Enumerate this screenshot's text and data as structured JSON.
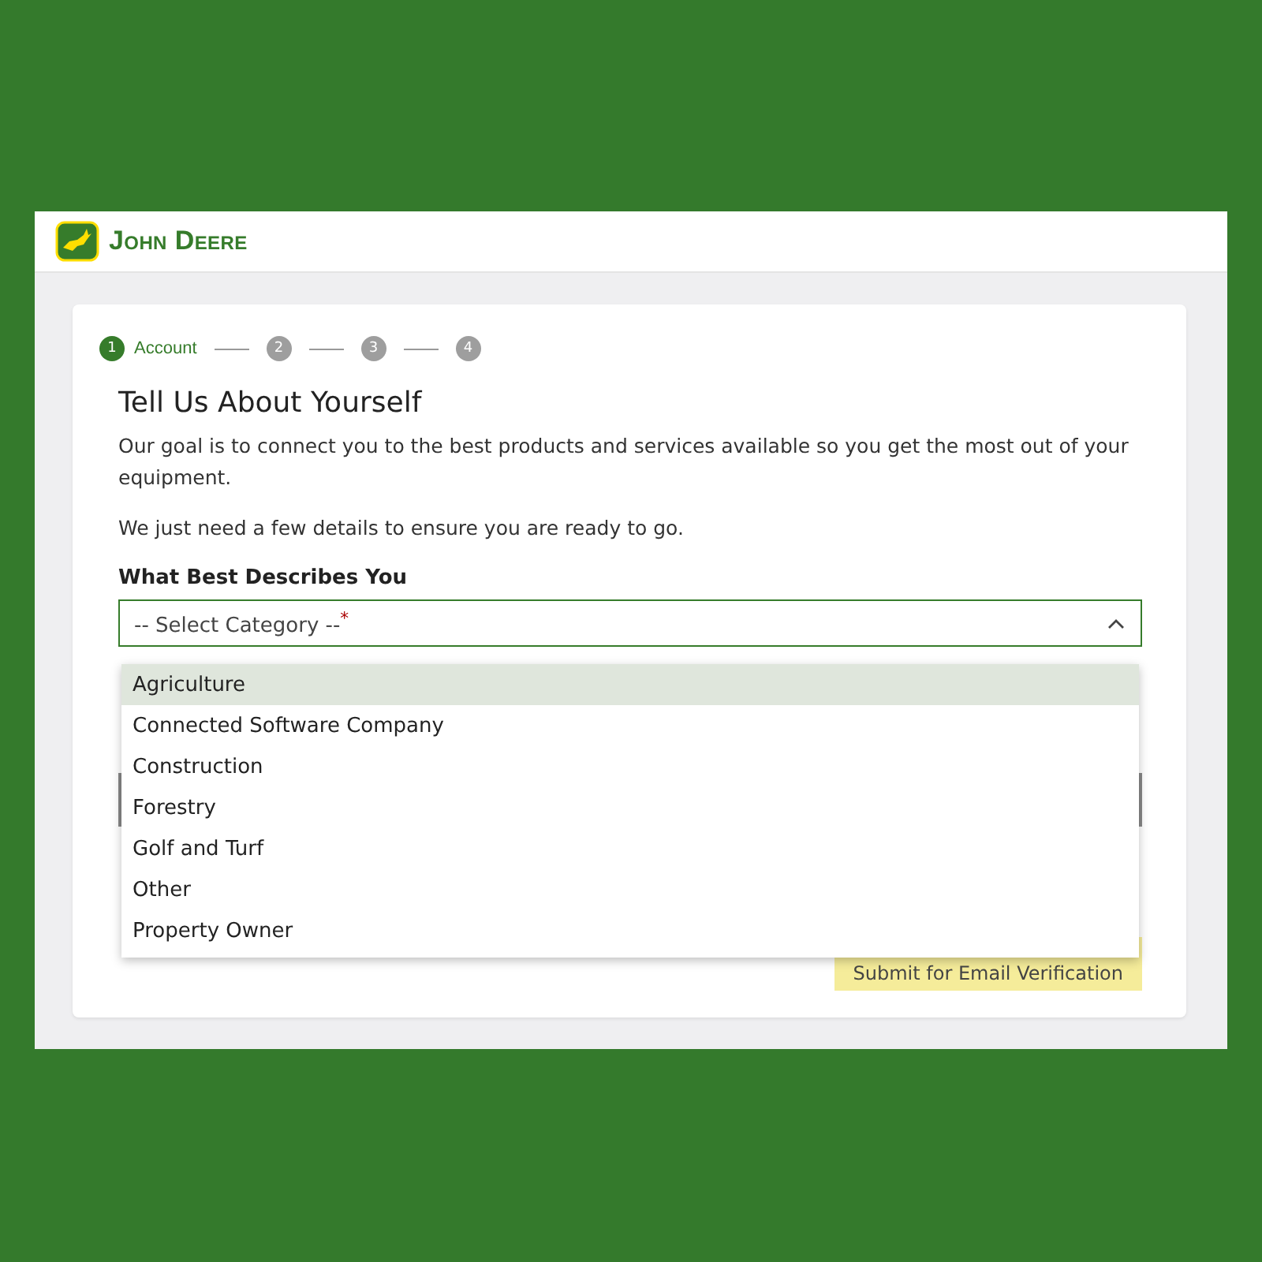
{
  "header": {
    "brand": "John Deere"
  },
  "stepper": [
    {
      "number": "1",
      "label": "Account",
      "active": true
    },
    {
      "number": "2",
      "active": false
    },
    {
      "number": "3",
      "active": false
    },
    {
      "number": "4",
      "active": false
    }
  ],
  "form": {
    "title": "Tell Us About Yourself",
    "intro": "Our goal is to connect you to the best products and services available so you get the most out of your equipment.",
    "note": "We just need a few details to ensure you are ready to go.",
    "field_label": "What Best Describes You",
    "select": {
      "placeholder": "-- Select Category --",
      "required_mark": "*",
      "expanded": true
    },
    "options": [
      {
        "label": "Agriculture",
        "selected": true
      },
      {
        "label": "Connected Software Company",
        "selected": false
      },
      {
        "label": "Construction",
        "selected": false
      },
      {
        "label": "Forestry",
        "selected": false
      },
      {
        "label": "Golf and Turf",
        "selected": false
      },
      {
        "label": "Other",
        "selected": false
      },
      {
        "label": "Property Owner",
        "selected": false
      }
    ],
    "submit": "Submit for Email Verification"
  }
}
